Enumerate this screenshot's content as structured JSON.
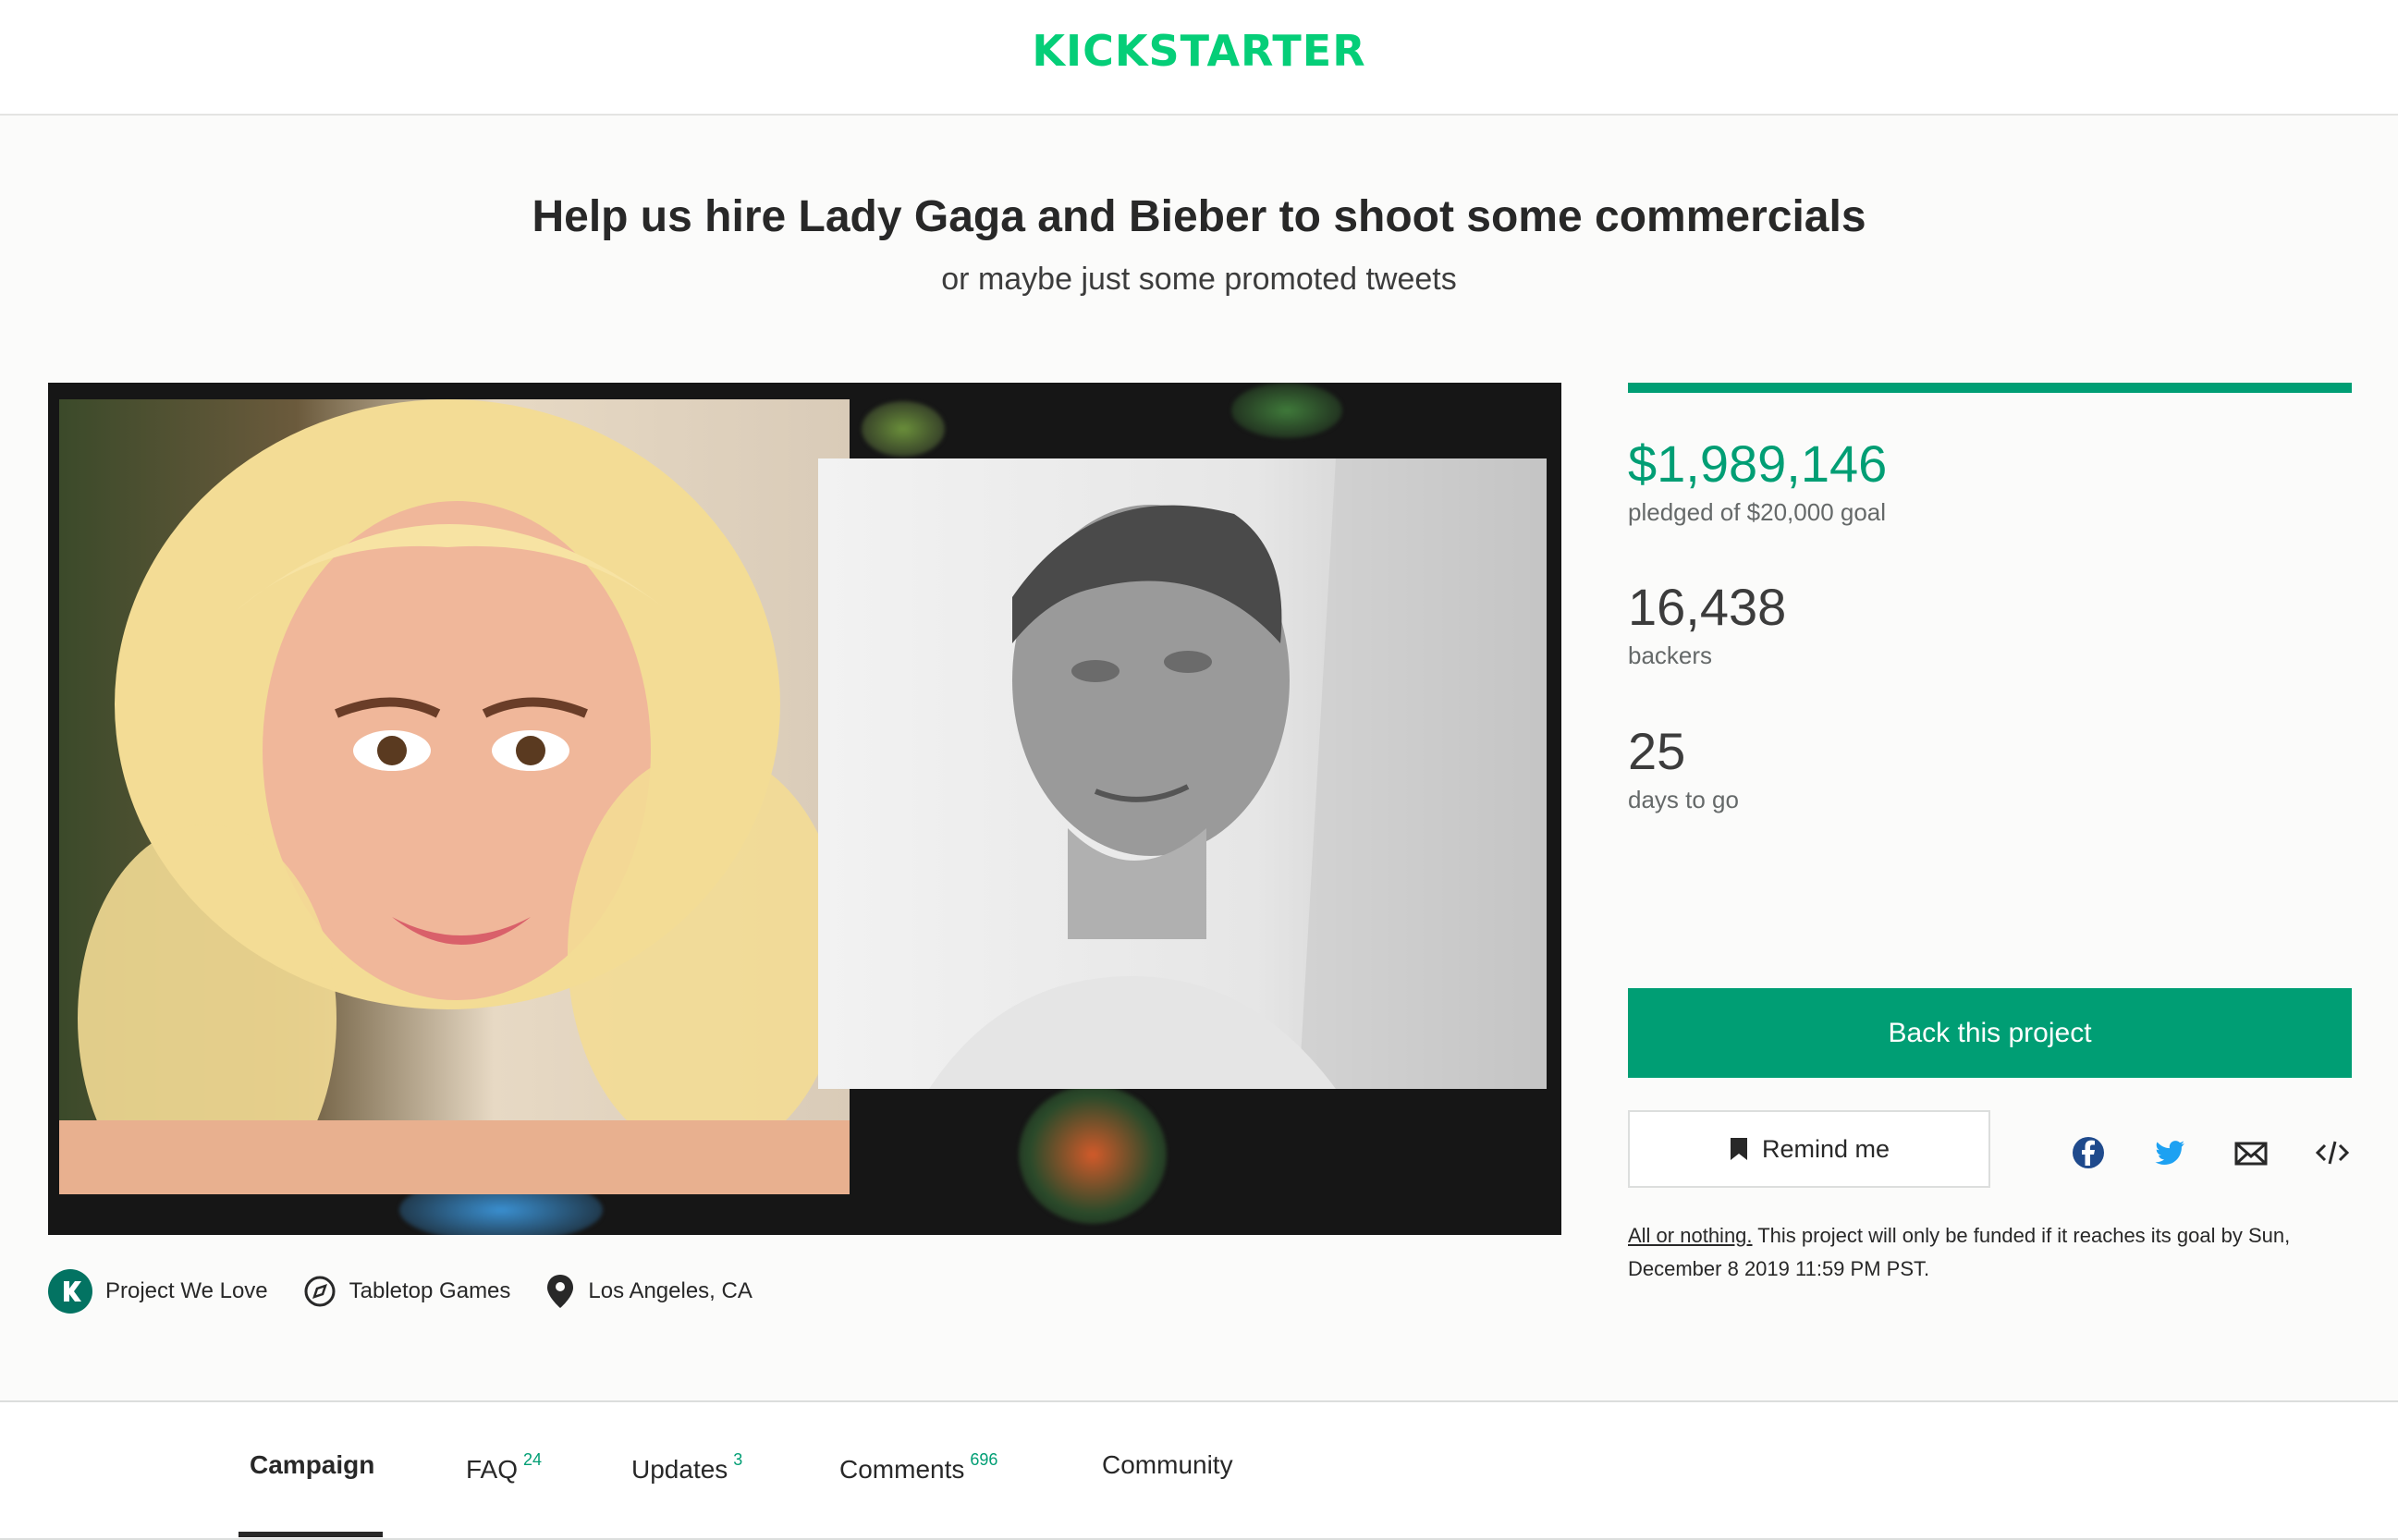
{
  "header": {
    "logo_text": "KICKSTARTER",
    "brand_color": "#05ce78"
  },
  "project": {
    "title": "Help us hire Lady Gaga and Bieber to shoot some commercials",
    "subtitle": "or maybe just some promoted tweets"
  },
  "meta": {
    "badge": "Project We Love",
    "category": "Tabletop Games",
    "location": "Los Angeles, CA"
  },
  "stats": {
    "pledged": "$1,989,146",
    "pledged_sub": "pledged of $20,000 goal",
    "backers": "16,438",
    "backers_label": "backers",
    "days": "25",
    "days_label": "days to go",
    "progress_fraction": 1.0
  },
  "actions": {
    "back_label": "Back this project",
    "remind_label": "Remind me",
    "share_icons": [
      "facebook-icon",
      "twitter-icon",
      "email-icon",
      "embed-icon"
    ]
  },
  "funding_note": {
    "link": "All or nothing.",
    "text": " This project will only be funded if it reaches its goal by Sun, December 8 2019 11:59 PM PST."
  },
  "tabs": [
    {
      "label": "Campaign",
      "count": ""
    },
    {
      "label": "FAQ",
      "count": "24"
    },
    {
      "label": "Updates",
      "count": "3"
    },
    {
      "label": "Comments",
      "count": "696"
    },
    {
      "label": "Community",
      "count": ""
    }
  ],
  "colors": {
    "accent": "#009e74",
    "brand": "#05ce78",
    "text": "#282828"
  }
}
